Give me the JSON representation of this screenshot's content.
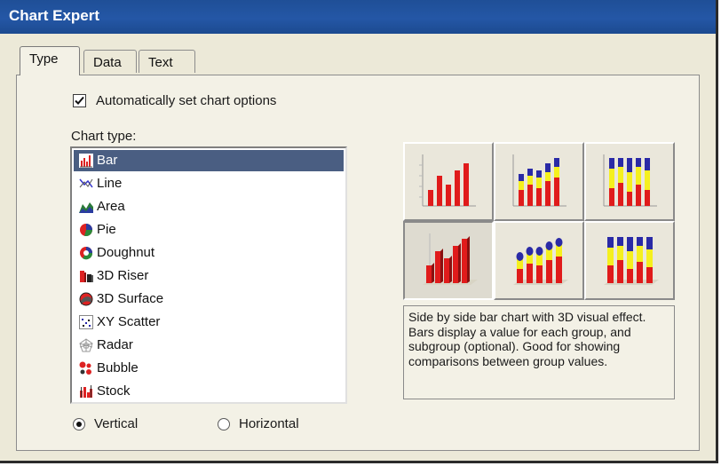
{
  "window": {
    "title": "Chart Expert"
  },
  "tabs": [
    {
      "label": "Type",
      "active": true
    },
    {
      "label": "Data",
      "active": false
    },
    {
      "label": "Text",
      "active": false
    }
  ],
  "auto_options": {
    "label": "Automatically set chart options",
    "checked": true
  },
  "chart_type": {
    "label": "Chart type:",
    "items": [
      {
        "label": "Bar",
        "icon": "bar-chart-icon",
        "selected": true
      },
      {
        "label": "Line",
        "icon": "line-chart-icon",
        "selected": false
      },
      {
        "label": "Area",
        "icon": "area-chart-icon",
        "selected": false
      },
      {
        "label": "Pie",
        "icon": "pie-chart-icon",
        "selected": false
      },
      {
        "label": "Doughnut",
        "icon": "doughnut-chart-icon",
        "selected": false
      },
      {
        "label": "3D Riser",
        "icon": "3d-riser-icon",
        "selected": false
      },
      {
        "label": "3D Surface",
        "icon": "3d-surface-icon",
        "selected": false
      },
      {
        "label": "XY Scatter",
        "icon": "xy-scatter-icon",
        "selected": false
      },
      {
        "label": "Radar",
        "icon": "radar-chart-icon",
        "selected": false
      },
      {
        "label": "Bubble",
        "icon": "bubble-chart-icon",
        "selected": false
      },
      {
        "label": "Stock",
        "icon": "stock-chart-icon",
        "selected": false
      }
    ]
  },
  "orientation": {
    "vertical": {
      "label": "Vertical",
      "selected": true
    },
    "horizontal": {
      "label": "Horizontal",
      "selected": false
    }
  },
  "subtypes": [
    {
      "name": "side-by-side-bar",
      "pressed": false
    },
    {
      "name": "stacked-bar",
      "pressed": false
    },
    {
      "name": "percent-bar",
      "pressed": false
    },
    {
      "name": "side-by-side-bar-3d",
      "pressed": true
    },
    {
      "name": "stacked-bar-3d",
      "pressed": false
    },
    {
      "name": "percent-bar-3d",
      "pressed": false
    }
  ],
  "description": "Side by side bar chart with 3D visual effect. Bars display a value for each group, and subgroup (optional). Good for showing comparisons between group values.",
  "colors": {
    "title_bar": "#1f4f97",
    "selection": "#4a5e82",
    "bar_red": "#e01b1b",
    "bar_blue": "#2a2aa6",
    "bar_yellow": "#f5f01e"
  }
}
